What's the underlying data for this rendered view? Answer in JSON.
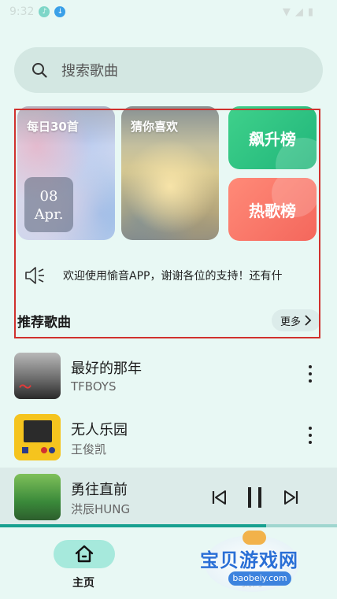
{
  "status_bar": {
    "time": "9:32"
  },
  "search": {
    "placeholder": "搜索歌曲"
  },
  "cards": {
    "daily": {
      "label": "每日30首",
      "day": "08",
      "month": "Apr."
    },
    "guess": {
      "label": "猜你喜欢"
    },
    "soar": {
      "label": "飙升榜"
    },
    "hot": {
      "label": "热歌榜"
    }
  },
  "notice": {
    "text": "欢迎使用愉音APP，谢谢各位的支持！还有什"
  },
  "section": {
    "title": "推荐歌曲",
    "more_label": "更多"
  },
  "songs": [
    {
      "name": "最好的那年",
      "artist": "TFBOYS"
    },
    {
      "name": "无人乐园",
      "artist": "王俊凯"
    }
  ],
  "now_playing": {
    "name": "勇往直前",
    "artist": "洪辰HUNG",
    "progress": 0.79
  },
  "bottom_nav": {
    "home_label": "主页",
    "me_label": "我的"
  },
  "watermark": {
    "text": "宝贝游戏网",
    "url": "baobeiy.com"
  },
  "colors": {
    "accent": "#18a090",
    "soar": "#2fc482",
    "hot": "#f4675c",
    "highlight": "#d0312d"
  }
}
